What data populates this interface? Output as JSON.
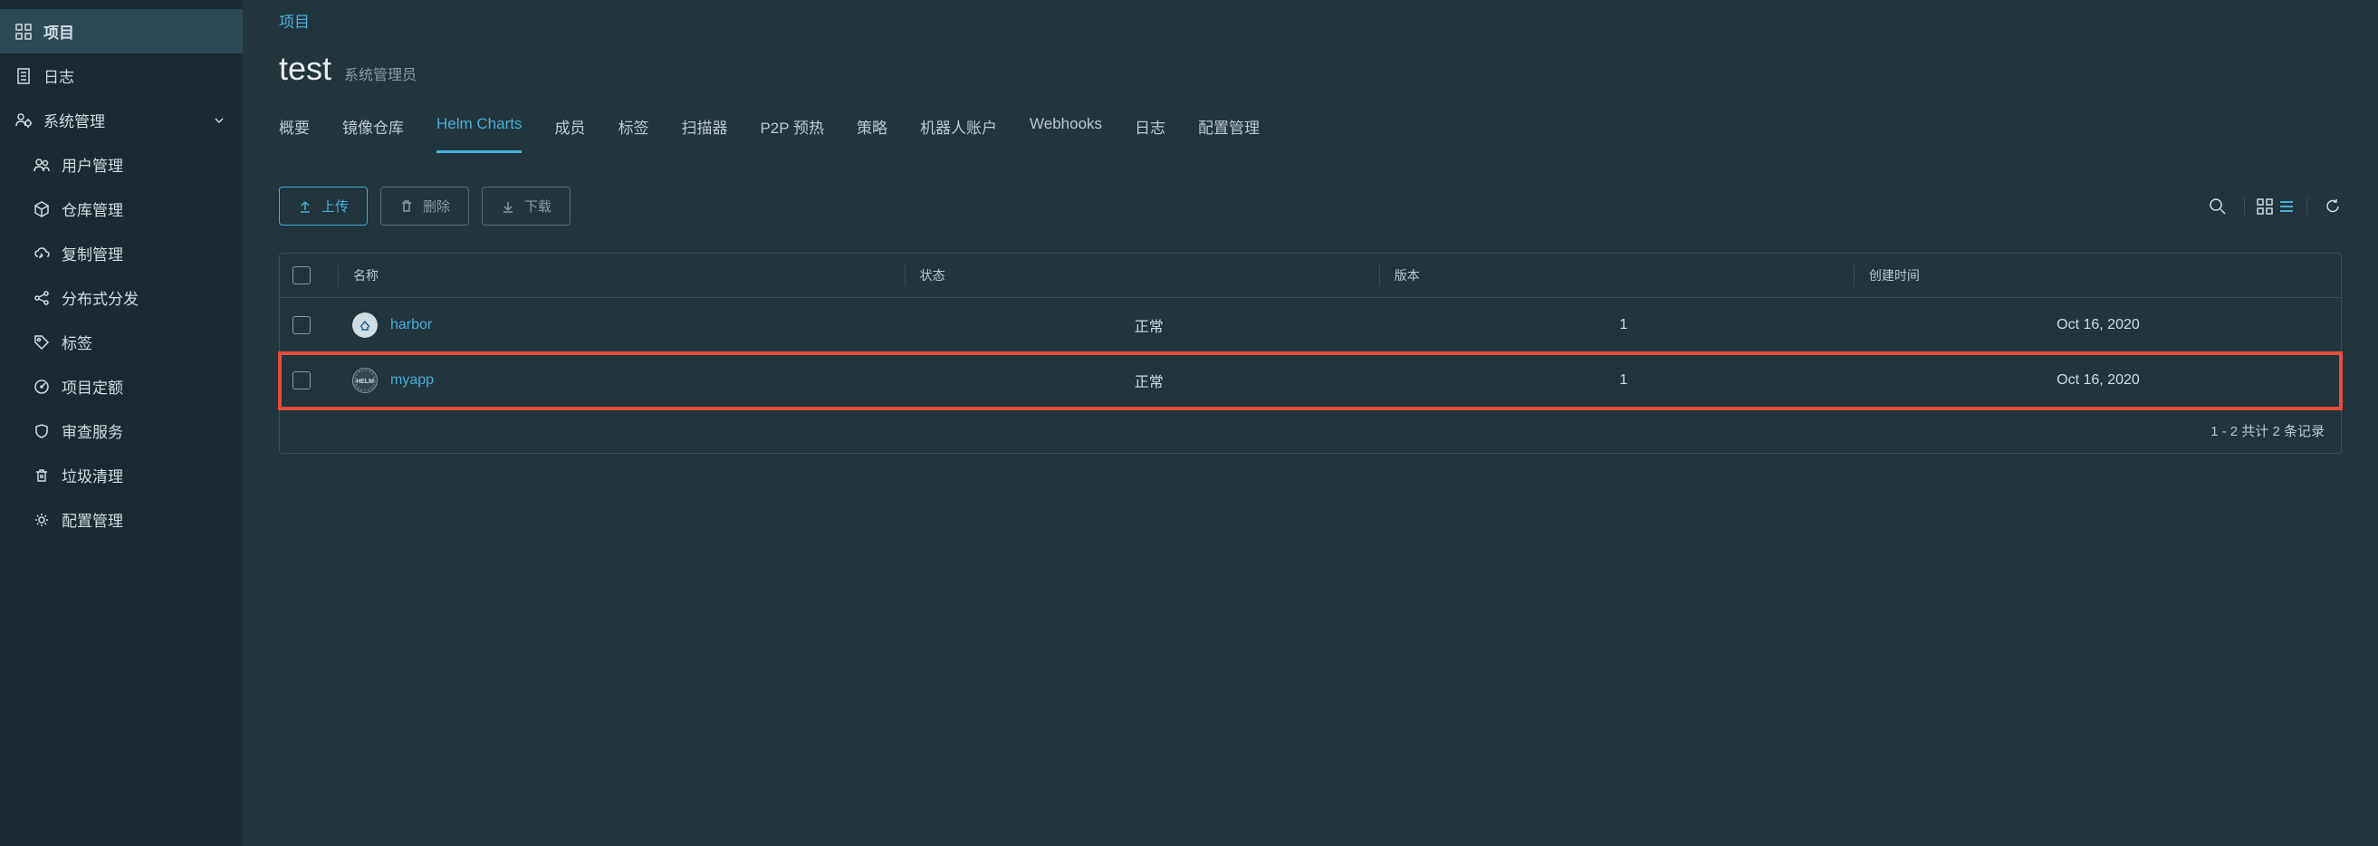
{
  "sidebar": {
    "items": [
      {
        "label": "项目"
      },
      {
        "label": "日志"
      },
      {
        "label": "系统管理"
      }
    ],
    "subitems": [
      {
        "label": "用户管理"
      },
      {
        "label": "仓库管理"
      },
      {
        "label": "复制管理"
      },
      {
        "label": "分布式分发"
      },
      {
        "label": "标签"
      },
      {
        "label": "项目定额"
      },
      {
        "label": "审查服务"
      },
      {
        "label": "垃圾清理"
      },
      {
        "label": "配置管理"
      }
    ]
  },
  "breadcrumb": "项目",
  "page": {
    "title": "test",
    "role": "系统管理员"
  },
  "tabs": [
    {
      "label": "概要"
    },
    {
      "label": "镜像仓库"
    },
    {
      "label": "Helm Charts"
    },
    {
      "label": "成员"
    },
    {
      "label": "标签"
    },
    {
      "label": "扫描器"
    },
    {
      "label": "P2P 预热"
    },
    {
      "label": "策略"
    },
    {
      "label": "机器人账户"
    },
    {
      "label": "Webhooks"
    },
    {
      "label": "日志"
    },
    {
      "label": "配置管理"
    }
  ],
  "toolbar": {
    "upload": "上传",
    "delete": "删除",
    "download": "下载"
  },
  "table": {
    "columns": {
      "name": "名称",
      "status": "状态",
      "version": "版本",
      "created": "创建时间"
    },
    "rows": [
      {
        "name": "harbor",
        "status": "正常",
        "version": "1",
        "created": "Oct 16, 2020",
        "iconType": "harbor"
      },
      {
        "name": "myapp",
        "status": "正常",
        "version": "1",
        "created": "Oct 16, 2020",
        "iconType": "helm"
      }
    ],
    "footer": "1 - 2 共计 2 条记录"
  }
}
